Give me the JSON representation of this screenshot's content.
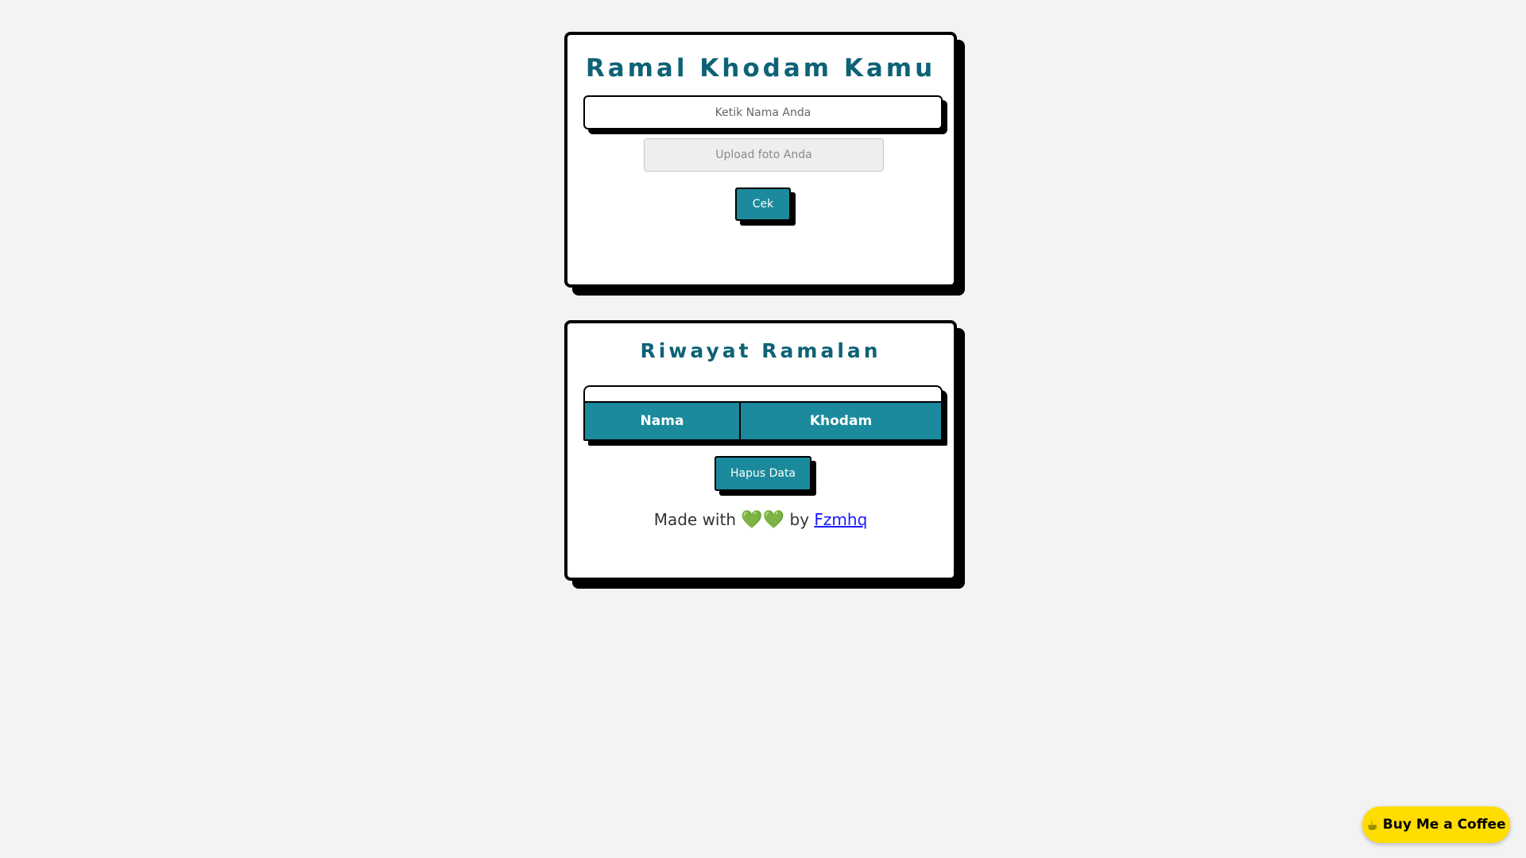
{
  "ramal": {
    "title": "Ramal Khodam Kamu",
    "name_placeholder": "Ketik Nama Anda",
    "upload_label": "Upload foto Anda",
    "submit_label": "Cek"
  },
  "riwayat": {
    "title": "Riwayat Ramalan",
    "columns": [
      "Nama",
      "Khodam"
    ],
    "rows": [],
    "clear_label": "Hapus Data"
  },
  "footer": {
    "made_with": "Made with",
    "hearts": "💚💚",
    "by": "by",
    "author": "Fzmhq"
  },
  "coffee": {
    "label": "Buy Me a Coffee",
    "icon": "coffee-cup-icon",
    "color": "#ffdd00"
  },
  "colors": {
    "accent": "#1a8a9c",
    "title": "#0e6275",
    "background": "#f3f3f3"
  }
}
